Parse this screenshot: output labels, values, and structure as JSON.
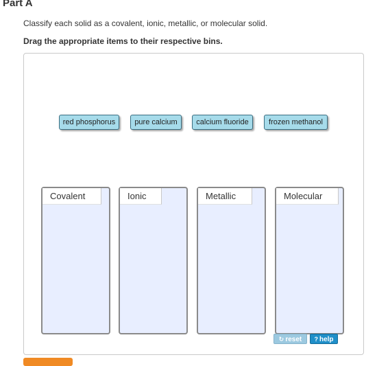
{
  "part": {
    "title": "Part A"
  },
  "question": {
    "instruction": "Classify each solid as a covalent, ionic, metallic, or molecular solid.",
    "drag_instruction": "Drag the appropriate items to their respective bins."
  },
  "items": [
    {
      "label": "red phosphorus"
    },
    {
      "label": "pure calcium"
    },
    {
      "label": "calcium fluoride"
    },
    {
      "label": "frozen methanol"
    }
  ],
  "bins": [
    {
      "label": "Covalent"
    },
    {
      "label": "Ionic"
    },
    {
      "label": "Metallic"
    },
    {
      "label": "Molecular"
    }
  ],
  "controls": {
    "reset_label": "reset",
    "help_label": "help",
    "reset_icon": "refresh-icon",
    "help_icon": "question-icon"
  },
  "colors": {
    "item_fill": "#a6dbea",
    "bin_fill": "#e8eeff",
    "help_button": "#1f8fc9",
    "submit_button": "#f08a24"
  }
}
